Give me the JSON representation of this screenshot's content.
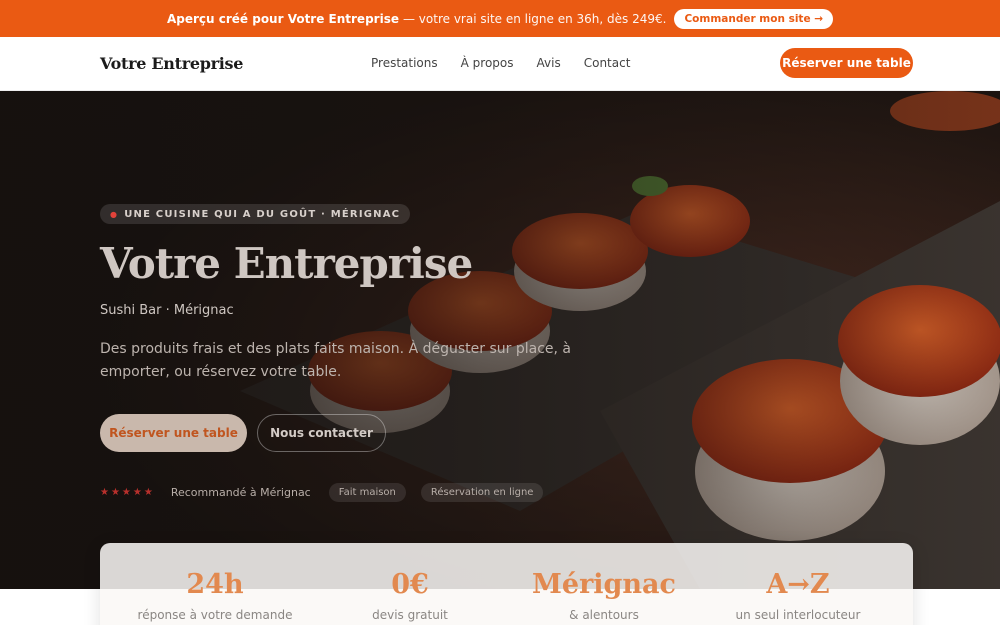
{
  "promo": {
    "highlight": "Aperçu créé pour Votre Entreprise",
    "text": "— votre vrai site en ligne en 36h, dès 249€.",
    "cta": "Commander mon site →"
  },
  "nav": {
    "brand": "Votre Entreprise",
    "items": [
      "Prestations",
      "À propos",
      "Avis",
      "Contact"
    ],
    "cta": "Réserver une table"
  },
  "hero": {
    "eyebrow": "UNE CUISINE QUI A DU GOÛT · MÉRIGNAC",
    "title": "Votre Entreprise",
    "subtitle": "Sushi Bar · Mérignac",
    "description": "Des produits frais et des plats faits maison. À déguster sur place, à emporter, ou réservez votre table.",
    "primary_cta": "Réserver une table",
    "secondary_cta": "Nous contacter",
    "stars": "★★★★★",
    "recommendation": "Recommandé à Mérignac",
    "chips": [
      "Fait maison",
      "Réservation en ligne"
    ]
  },
  "stats": [
    {
      "value": "24h",
      "label": "réponse à votre demande"
    },
    {
      "value": "0€",
      "label": "devis gratuit"
    },
    {
      "value": "Mérignac",
      "label": "& alentours"
    },
    {
      "value": "A→Z",
      "label": "un seul interlocuteur"
    }
  ],
  "colors": {
    "accent": "#ea5a13",
    "stat_value": "#e2894f"
  }
}
